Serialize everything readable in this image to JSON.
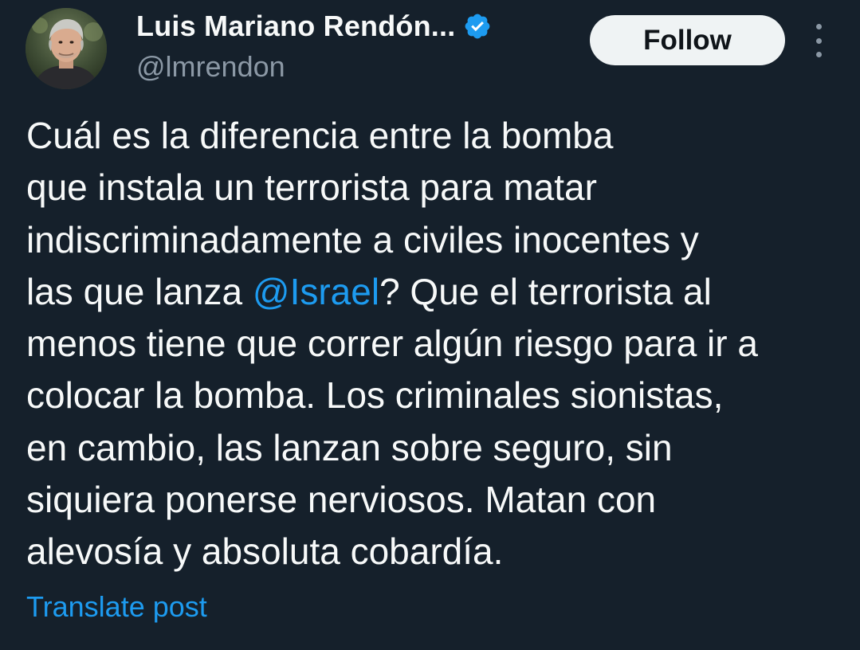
{
  "author": {
    "display_name": "Luis Mariano Rendón...",
    "handle": "@lmrendon",
    "verified": true,
    "avatar_icon": "user-photo"
  },
  "actions": {
    "follow_label": "Follow",
    "more_icon": "more-vertical-icon"
  },
  "post": {
    "lines": [
      {
        "text": "Cuál es la diferencia entre la bomba"
      },
      {
        "text": "que instala un terrorista para matar"
      },
      {
        "text": "indiscriminadamente a civiles inocentes y"
      },
      {
        "before": "las que lanza ",
        "mention": "@Israel",
        "after": "? Que el terrorista al"
      },
      {
        "text": "menos tiene que correr algún riesgo para ir a"
      },
      {
        "text": "colocar la bomba. Los criminales sionistas,"
      },
      {
        "text": "en cambio, las lanzan sobre seguro, sin"
      },
      {
        "text": "siquiera ponerse nerviosos. Matan con"
      },
      {
        "text": "alevosía y absoluta cobardía."
      }
    ]
  },
  "translate_label": "Translate post",
  "colors": {
    "background": "#15202b",
    "text": "#f7f9f9",
    "secondary_text": "#8b98a5",
    "link": "#1d9bf0",
    "verified_badge": "#1d9bf0",
    "follow_button_bg": "#eff3f4"
  }
}
